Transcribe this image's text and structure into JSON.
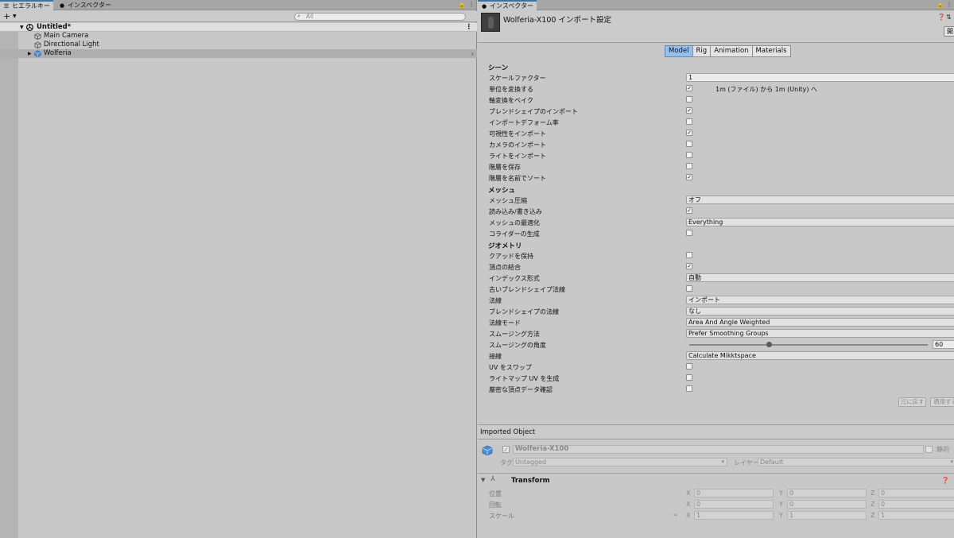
{
  "hierarchy": {
    "tabs": [
      {
        "label": "ヒエラルキー",
        "icon": "list-icon"
      },
      {
        "label": "インスペクター",
        "icon": "info-icon"
      }
    ],
    "search_placeholder": "All",
    "scene": {
      "name": "Untitled*"
    },
    "items": [
      {
        "label": "Main Camera"
      },
      {
        "label": "Directional Light"
      },
      {
        "label": "Wolferia"
      }
    ]
  },
  "inspector": {
    "tab_label": "インスペクター",
    "title": "Wolferia-X100 インポート設定",
    "open_button": "開",
    "tabs": [
      "Model",
      "Rig",
      "Animation",
      "Materials"
    ],
    "active_tab": "Model",
    "sections": {
      "scene": "シーン",
      "mesh": "メッシュ",
      "geometry": "ジオメトリ"
    },
    "scene_props": {
      "scale_factor": {
        "label": "スケールファクター",
        "value": "1"
      },
      "convert_units": {
        "label": "単位を変換する",
        "checked": true,
        "note": "1m (ファイル) から 1m (Unity) へ"
      },
      "bake_axis": {
        "label": "軸変換をベイク",
        "checked": false
      },
      "import_blendshapes": {
        "label": "ブレンドシェイプのインポート",
        "checked": true
      },
      "import_deform": {
        "label": "インポートデフォーム率",
        "checked": false
      },
      "import_visibility": {
        "label": "可視性をインポート",
        "checked": true
      },
      "import_cameras": {
        "label": "カメラのインポート",
        "checked": false
      },
      "import_lights": {
        "label": "ライトをインポート",
        "checked": false
      },
      "preserve_hierarchy": {
        "label": "階層を保存",
        "checked": false
      },
      "sort_hierarchy": {
        "label": "階層を名前でソート",
        "checked": true
      }
    },
    "mesh_props": {
      "compression": {
        "label": "メッシュ圧縮",
        "value": "オフ"
      },
      "read_write": {
        "label": "読み込み/書き込み",
        "checked": true
      },
      "optimize": {
        "label": "メッシュの最適化",
        "value": "Everything"
      },
      "colliders": {
        "label": "コライダーの生成",
        "checked": false
      }
    },
    "geometry_props": {
      "keep_quads": {
        "label": "クアッドを保持",
        "checked": false
      },
      "weld_vertices": {
        "label": "頂点の結合",
        "checked": true
      },
      "index_format": {
        "label": "インデックス形式",
        "value": "自動"
      },
      "legacy_blendshape_normals": {
        "label": "古いブレンドシェイプ法線",
        "checked": false
      },
      "normals": {
        "label": "法線",
        "value": "インポート"
      },
      "blendshape_normals": {
        "label": "ブレンドシェイプの法線",
        "value": "なし"
      },
      "normals_mode": {
        "label": "法線モード",
        "value": "Area And Angle Weighted"
      },
      "smoothness_source": {
        "label": "スムージング方法",
        "value": "Prefer Smoothing Groups"
      },
      "smoothing_angle": {
        "label": "スムージングの角度",
        "value": "60",
        "fraction": 0.333
      },
      "tangents": {
        "label": "接線",
        "value": "Calculate Mikktspace"
      },
      "swap_uvs": {
        "label": "UV をスワップ",
        "checked": false
      },
      "lightmap_uvs": {
        "label": "ライトマップ UV を生成",
        "checked": false
      },
      "strict_vertex": {
        "label": "厳密な頂点データ確認",
        "checked": false
      }
    },
    "revert_button": "元に戻す",
    "apply_button": "適用する",
    "imported_object": {
      "header": "Imported Object",
      "name": "Wolferia-X100",
      "static_label": "静的",
      "tag_label": "タグ",
      "tag_value": "Untagged",
      "layer_label": "レイヤー",
      "layer_value": "Default"
    },
    "transform": {
      "title": "Transform",
      "rows": [
        {
          "label": "位置",
          "x": "0",
          "y": "0",
          "z": "0"
        },
        {
          "label": "回転",
          "x": "0",
          "y": "0",
          "z": "0"
        },
        {
          "label": "スケール",
          "x": "1",
          "y": "1",
          "z": "1"
        }
      ],
      "axis_labels": [
        "X",
        "Y",
        "Z"
      ]
    }
  },
  "colors": {
    "accent": "#96bff0",
    "tab_highlight": "#3a72b0"
  }
}
